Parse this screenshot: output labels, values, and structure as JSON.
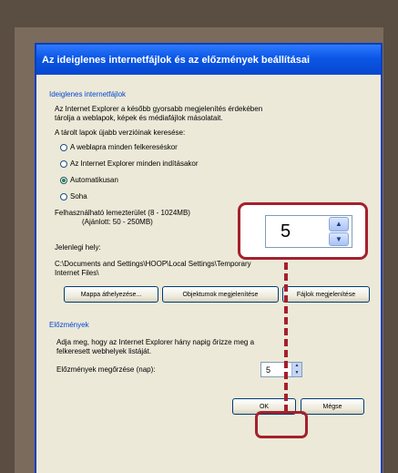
{
  "dialog": {
    "title": "Az ideiglenes internetfájlok és az előzmények beállításai"
  },
  "temp_files": {
    "group_label": "Ideiglenes internetfájlok",
    "description_line1": "Az Internet Explorer a később gyorsabb megjelenítés érdekében",
    "description_line2": "tárolja a weblapok, képek és médiafájlok másolatait.",
    "check_prompt": "A tárolt lapok újabb verzióinak keresése:",
    "options": [
      {
        "label": "A weblapra minden felkereséskor",
        "checked": false
      },
      {
        "label": "Az Internet Explorer minden indításakor",
        "checked": false
      },
      {
        "label": "Automatikusan",
        "checked": true
      },
      {
        "label": "Soha",
        "checked": false
      }
    ],
    "disk_space_label_line1": "Felhasználható lemezterület (8 - 1024MB)",
    "disk_space_label_line2": "(Ajánlott: 50 - 250MB)",
    "location_label": "Jelenlegi hely:",
    "location_path_line1": "C:\\Documents and Settings\\HOOP\\Local Settings\\Temporary",
    "location_path_line2": "Internet Files\\",
    "buttons": {
      "move_folder": "Mappa áthelyezése...",
      "view_objects": "Objektumok megjelenítése",
      "view_files": "Fájlok megjelenítése"
    }
  },
  "history": {
    "group_label": "Előzmények",
    "description_line1": "Adja meg, hogy az Internet Explorer hány napig őrizze meg a",
    "description_line2": "felkeresett webhelyek listáját.",
    "days_label": "Előzmények megőrzése (nap):",
    "days_value": "5"
  },
  "zoom_callout": {
    "value": "5"
  },
  "footer": {
    "ok_label": "OK",
    "cancel_label": "Mégse"
  },
  "colors": {
    "callout": "#a5202d",
    "titlebar": "#0b56e5"
  }
}
